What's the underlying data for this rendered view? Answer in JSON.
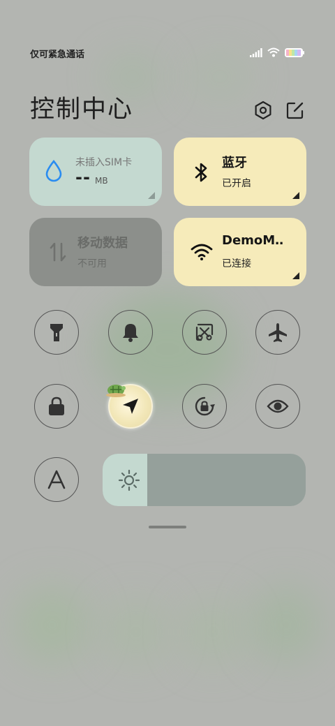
{
  "status_bar": {
    "carrier_text": "仅可紧急通话",
    "icons": [
      "signal-icon",
      "wifi-icon",
      "battery-icon"
    ]
  },
  "header": {
    "title": "控制中心",
    "icons": [
      "settings-icon",
      "edit-icon"
    ]
  },
  "tiles": {
    "sim": {
      "title": "未插入SIM卡",
      "value": "--",
      "unit": "MB",
      "icon": "water-drop-icon"
    },
    "bluetooth": {
      "title": "蓝牙",
      "status": "已开启",
      "icon": "bluetooth-icon"
    },
    "mobile_data": {
      "title": "移动数据",
      "status": "不可用",
      "icon": "data-transfer-icon"
    },
    "wifi": {
      "title": "DemoM‥",
      "status": "已连接",
      "icon": "wifi-icon"
    }
  },
  "toggles": [
    {
      "icon": "flashlight-icon",
      "active": false
    },
    {
      "icon": "bell-icon",
      "active": false
    },
    {
      "icon": "screenshot-icon",
      "active": false
    },
    {
      "icon": "airplane-icon",
      "active": false
    },
    {
      "icon": "lock-icon",
      "active": false
    },
    {
      "icon": "location-icon",
      "active": true
    },
    {
      "icon": "rotation-lock-icon",
      "active": false
    },
    {
      "icon": "eye-icon",
      "active": false
    },
    {
      "icon": "auto-brightness-icon",
      "active": false
    }
  ],
  "brightness": {
    "level": 0.22,
    "icon": "sun-icon"
  },
  "colors": {
    "background": "#b3b5b1",
    "tile_teal": "#c4d9d0",
    "tile_yellow": "#f6ebba",
    "tile_disabled": "#8c8f8b",
    "accent_blue": "#2a8cf0"
  }
}
